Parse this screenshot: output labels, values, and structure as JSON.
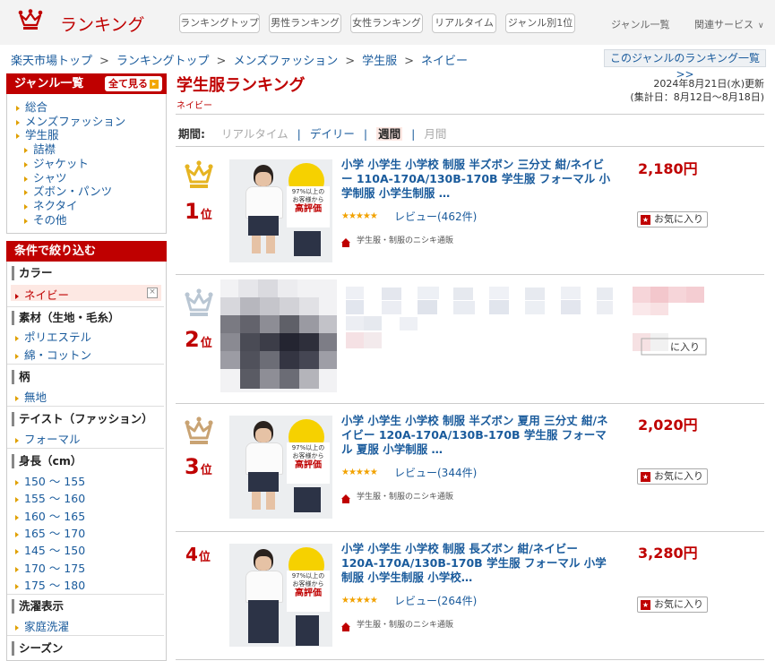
{
  "header": {
    "logo_text": "ランキング",
    "nav": [
      "ランキングトップ",
      "男性ランキング",
      "女性ランキング",
      "リアルタイム",
      "ジャンル別1位"
    ],
    "genre_list": "ジャンル一覧",
    "related": "関連サービス"
  },
  "breadcrumb": [
    "楽天市場トップ",
    "ランキングトップ",
    "メンズファッション",
    "学生服",
    "ネイビー"
  ],
  "breadcrumb_sep": ">",
  "genre_ranking_link": "このジャンルのランキング一覧 >>",
  "sidebar": {
    "genre_title": "ジャンル一覧",
    "show_all": "全て見る",
    "genres": [
      "総合",
      "メンズファッション",
      "学生服"
    ],
    "subgenres": [
      "詰襟",
      "ジャケット",
      "シャツ",
      "ズボン・パンツ",
      "ネクタイ",
      "その他"
    ],
    "filter_title": "条件で絞り込む",
    "color_title": "カラー",
    "color_selected": "ネイビー",
    "material_title": "素材（生地・毛糸）",
    "materials": [
      "ポリエステル",
      "綿・コットン"
    ],
    "pattern_title": "柄",
    "patterns": [
      "無地"
    ],
    "taste_title": "テイスト（ファッション）",
    "tastes": [
      "フォーマル"
    ],
    "height_title": "身長（cm）",
    "heights": [
      "150 ～ 155",
      "155 ～ 160",
      "160 ～ 165",
      "165 ～ 170",
      "145 ～ 150",
      "170 ～ 175",
      "175 ～ 180"
    ],
    "wash_title": "洗濯表示",
    "wash": [
      "家庭洗濯"
    ],
    "season_title": "シーズン"
  },
  "main": {
    "title": "学生服ランキング",
    "subtitle": "ネイビー",
    "updated": "2024年8月21日(水)更新",
    "period_range": "(集計日：8月12日～8月18日)",
    "period_label": "期間:",
    "periods": [
      "リアルタイム",
      "デイリー",
      "週間",
      "月間"
    ],
    "rank_unit": "位",
    "fav_label": "お気に入り",
    "items": [
      {
        "rank": "1",
        "title": "小学 小学生 小学校 制服 半ズボン 三分丈 紺/ネイビー 110A-170A/130B-170B 学生服 フォーマル 小学制服 小学生制服 …",
        "stars": "★★★★★",
        "review": "レビュー(462件)",
        "shop": "学生服・制服のニシキ通販",
        "price": "2,180円",
        "rating": 4.5
      },
      {
        "rank": "2",
        "title": "",
        "price": ""
      },
      {
        "rank": "3",
        "title": "小学 小学生 小学校 制服 半ズボン 夏用 三分丈 紺/ネイビー 120A-170A/130B-170B 学生服 フォーマル 夏服 小学制服 …",
        "stars": "★★★★★",
        "review": "レビュー(344件)",
        "shop": "学生服・制服のニシキ通販",
        "price": "2,020円",
        "rating": 4.5
      },
      {
        "rank": "4",
        "title": "小学 小学生 小学校 制服 長ズボン 紺/ネイビー 120A-170A/130B-170B 学生服 フォーマル 小学制服 小学生制服 小学校…",
        "stars": "★★★★★",
        "review": "レビュー(264件)",
        "shop": "学生服・制服のニシキ通販",
        "price": "3,280円",
        "rating": 4.5
      }
    ],
    "thumb_badge": {
      "line1": "97%以上の",
      "line2": "お客様から",
      "line3": "高評価"
    }
  },
  "colors": {
    "accent": "#bf0000",
    "link": "#1a5b9c",
    "star": "#f2a200",
    "crown_gold": "#e6b422",
    "crown_silver": "#b9c6d3",
    "crown_bronze": "#c9a373"
  }
}
